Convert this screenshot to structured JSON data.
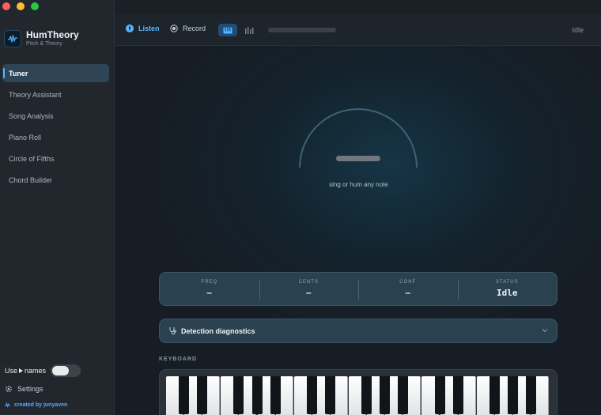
{
  "app": {
    "name": "HumTheory",
    "tagline": "Pitch & Theory"
  },
  "sidebar": {
    "items": [
      {
        "label": "Tuner",
        "active": true
      },
      {
        "label": "Theory Assistant",
        "active": false
      },
      {
        "label": "Song Analysis",
        "active": false
      },
      {
        "label": "Piano Roll",
        "active": false
      },
      {
        "label": "Circle of Fifths",
        "active": false
      },
      {
        "label": "Chord Builder",
        "active": false
      }
    ],
    "names_toggle": {
      "label_prefix": "Use",
      "label_suffix": "names",
      "enabled": false
    },
    "settings_label": "Settings",
    "credit": "created by junyaven"
  },
  "toolbar": {
    "listen_label": "Listen",
    "record_label": "Record",
    "view_modes": [
      "piano-keys-icon",
      "bars-icon"
    ],
    "active_view": "piano-keys-icon",
    "input_level": 0,
    "status": "Idle"
  },
  "tuner": {
    "note_placeholder": "—",
    "hint": "sing or hum any note"
  },
  "stats": [
    {
      "label": "FREQ",
      "value": "–"
    },
    {
      "label": "CENTS",
      "value": "–"
    },
    {
      "label": "CONF",
      "value": "–"
    },
    {
      "label": "STATUS",
      "value": "Idle"
    }
  ],
  "diagnostics": {
    "title": "Detection diagnostics",
    "expanded": false
  },
  "keyboard": {
    "label": "KEYBOARD"
  },
  "colors": {
    "accent": "#58b6ff",
    "sidebar_bg": "#22272e",
    "panel_bg": "#2a4250"
  }
}
